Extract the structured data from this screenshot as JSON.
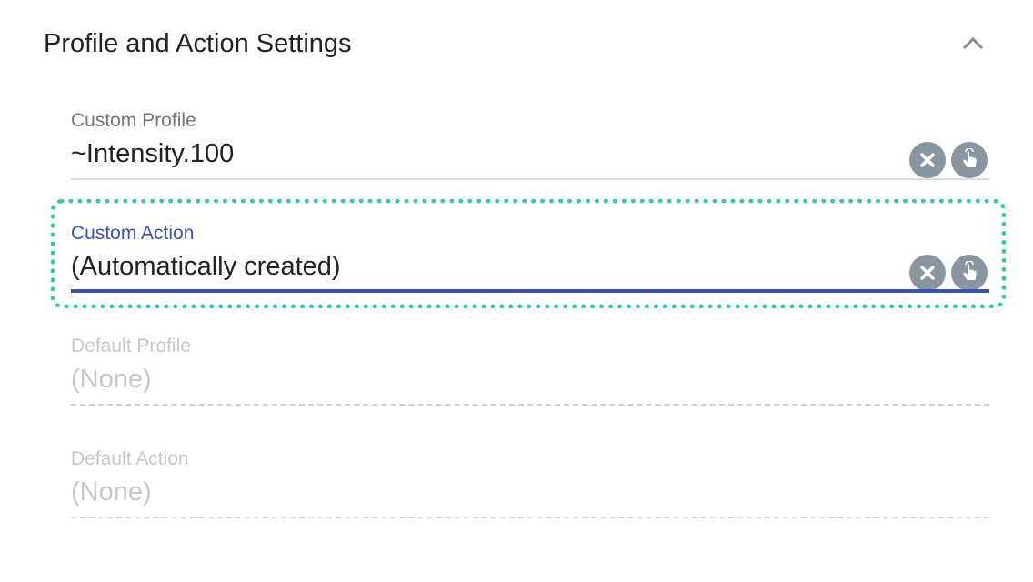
{
  "section": {
    "title": "Profile and Action Settings",
    "collapse_icon": "chevron-up-icon"
  },
  "fields": [
    {
      "label": "Custom Profile",
      "value": "~Intensity.100",
      "state": "normal",
      "buttons": [
        "clear-icon",
        "touch-select-icon"
      ]
    },
    {
      "label": "Custom Action",
      "value": "(Automatically created)",
      "state": "focused",
      "buttons": [
        "clear-icon",
        "touch-select-icon"
      ]
    },
    {
      "label": "Default Profile",
      "value": "(None)",
      "state": "disabled"
    },
    {
      "label": "Default Action",
      "value": "(None)",
      "state": "disabled"
    }
  ],
  "colors": {
    "accent": "#3f51b5",
    "highlight": "#34c9a7",
    "icon_bg": "#8996a2"
  }
}
